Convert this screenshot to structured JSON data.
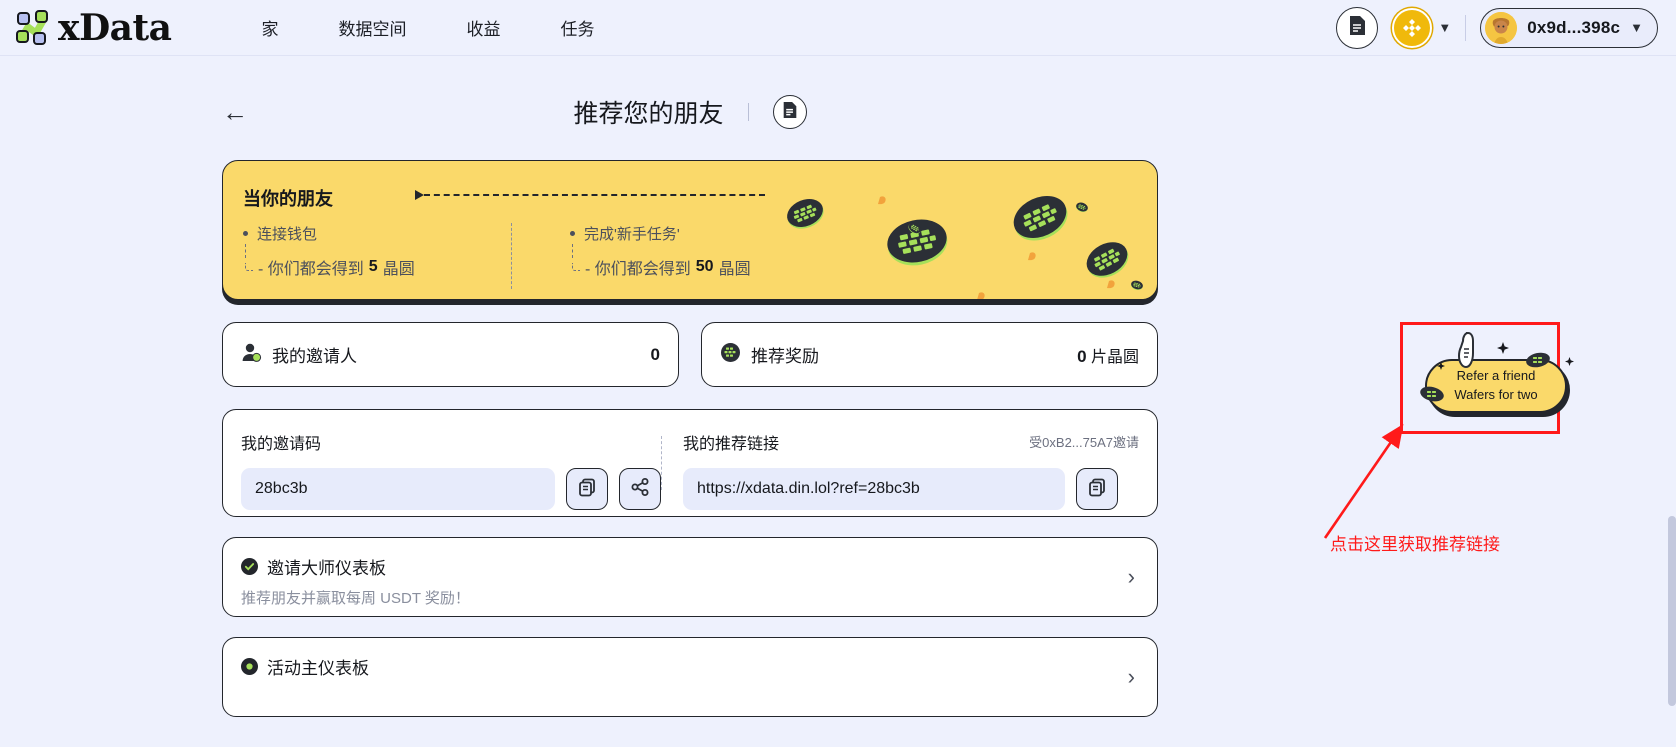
{
  "navbar": {
    "brand": "xData",
    "brand_logo_icon": "xdata-logo-icon",
    "links": [
      {
        "label": "家"
      },
      {
        "label": "数据空间"
      },
      {
        "label": "收益"
      },
      {
        "label": "任务"
      }
    ],
    "doc_icon": "document-icon",
    "chain_icon": "bnb-chain-icon",
    "chain_caret_icon": "chevron-down-icon",
    "wallet": {
      "avatar_icon": "user-avatar-icon",
      "address": "0x9d...398c",
      "caret_icon": "chevron-down-icon"
    }
  },
  "page_header": {
    "back_icon": "arrow-left-icon",
    "title": "推荐您的朋友",
    "doc_icon": "document-icon"
  },
  "banner": {
    "title": "当你的朋友",
    "columns": [
      {
        "step": "连接钱包",
        "reward_prefix": "- 你们都会得到 ",
        "reward_amount": "5",
        "reward_unit": " 晶圆"
      },
      {
        "step": "完成'新手任务'",
        "reward_prefix": "- 你们都会得到 ",
        "reward_amount": "50",
        "reward_unit": " 晶圆"
      }
    ],
    "bg_color": "#fad96a",
    "art_icon": "wafer-chips-illustration"
  },
  "stats": [
    {
      "icon": "person-icon",
      "label": "我的邀请人",
      "value": "0",
      "unit": ""
    },
    {
      "icon": "wafer-icon",
      "label": "推荐奖励",
      "value": "0",
      "unit": " 片晶圆"
    }
  ],
  "invite": {
    "code_label": "我的邀请码",
    "code_value": "28bc3b",
    "copy_icon": "copy-icon",
    "share_icon": "share-icon",
    "link_label": "我的推荐链接",
    "link_value": "https://xdata.din.lol?ref=28bc3b",
    "link_copy_icon": "copy-icon",
    "invited_by": "受0xB2...75A7邀请"
  },
  "rows": [
    {
      "icon": "check-badge-icon",
      "title": "邀请大师仪表板",
      "subtitle": "推荐朋友并赢取每周 USDT 奖励！",
      "chevron_icon": "chevron-right-icon"
    },
    {
      "icon": "activity-icon",
      "title": "活动主仪表板",
      "subtitle": "",
      "chevron_icon": "chevron-right-icon"
    }
  ],
  "refer_widget": {
    "line1": "Refer a friend",
    "line2": "Wafers for two",
    "hand_icon": "pointing-hand-icon",
    "highlight_color": "#ff1a1a"
  },
  "annotation": {
    "text": "点击这里获取推荐链接",
    "color": "#ff1a1a",
    "arrow_icon": "annotation-arrow-icon"
  }
}
